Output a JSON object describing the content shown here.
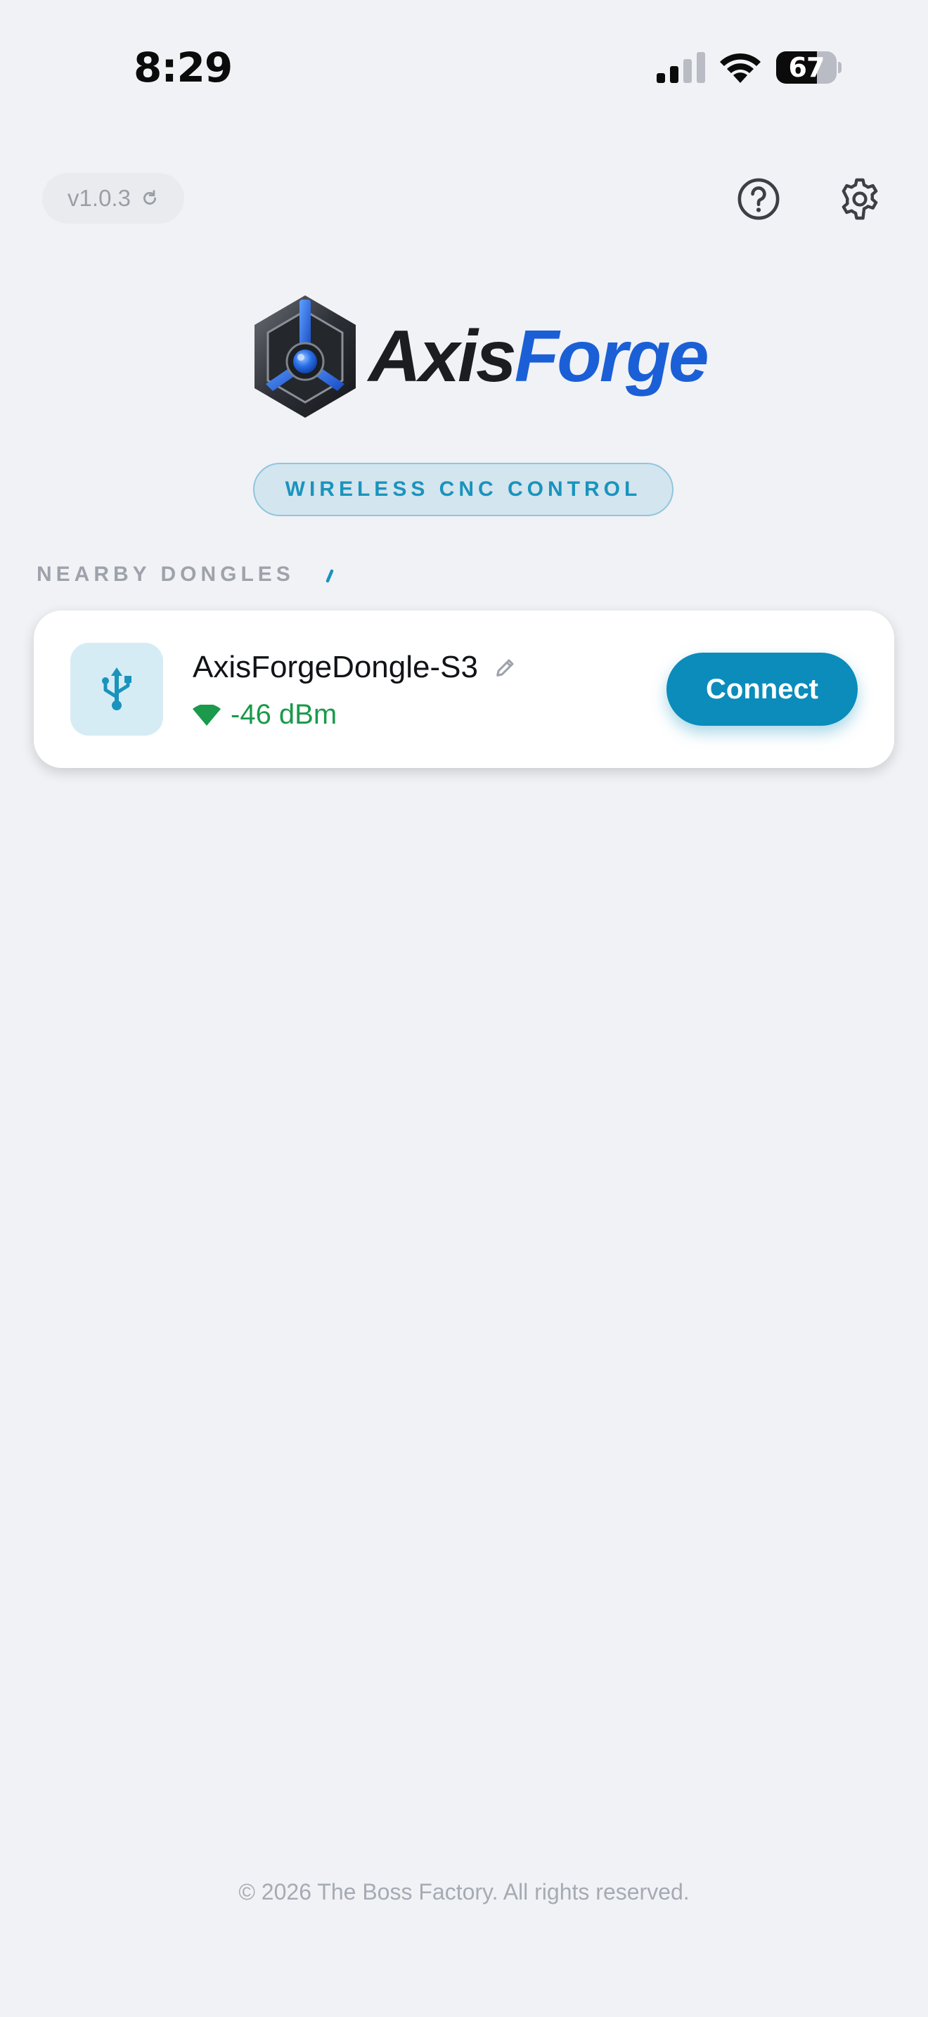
{
  "status_bar": {
    "time": "8:29",
    "battery_level": "67",
    "battery_fraction": 0.67
  },
  "header": {
    "version": "v1.0.3",
    "help_icon": "question-circle-icon",
    "settings_icon": "gear-icon"
  },
  "logo": {
    "word_part_1": "Axis",
    "word_part_2": "Forge"
  },
  "tagline": "WIRELESS CNC CONTROL",
  "nearby": {
    "section_title": "NEARBY DONGLES",
    "devices": [
      {
        "name": "AxisForgeDongle-S3",
        "signal": "-46 dBm",
        "icon": "usb-icon",
        "action_label": "Connect"
      }
    ]
  },
  "footer": "© 2026 The Boss Factory. All rights reserved.",
  "colors": {
    "accent": "#0b8cbb",
    "signal_good": "#1a9a4a",
    "brand_blue": "#1a5fd6",
    "background": "#f0f2f6"
  }
}
